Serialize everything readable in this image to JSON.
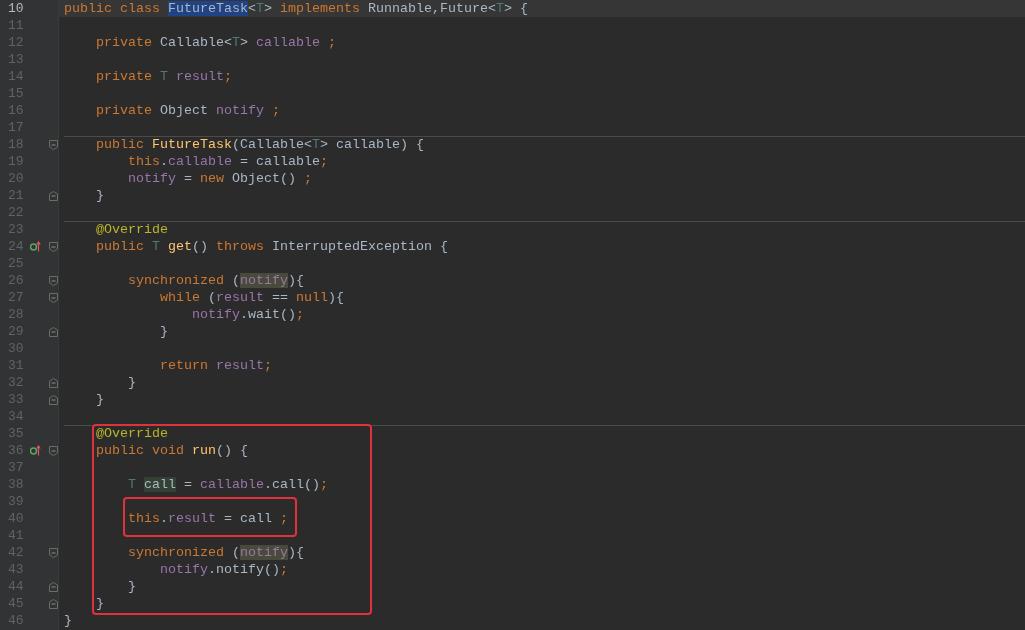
{
  "lines": [
    {
      "number": "10",
      "current": true,
      "separator": false,
      "marker": false,
      "tokens": [
        {
          "text": "public class ",
          "kind": "keyword"
        },
        {
          "text": "FutureTask",
          "kind": "selection"
        },
        {
          "text": "<",
          "kind": "plain"
        },
        {
          "text": "T",
          "kind": "type_param"
        },
        {
          "text": "> ",
          "kind": "plain"
        },
        {
          "text": "implements ",
          "kind": "keyword"
        },
        {
          "text": "Runnable,Future<",
          "kind": "plain"
        },
        {
          "text": "T",
          "kind": "type_param"
        },
        {
          "text": "> {",
          "kind": "plain"
        }
      ]
    },
    {
      "number": "11",
      "current": false,
      "separator": false,
      "marker": false
    },
    {
      "number": "12",
      "current": false,
      "separator": false,
      "marker": false,
      "tokens": [
        {
          "text": "    private ",
          "kind": "keyword"
        },
        {
          "text": "Callable<",
          "kind": "plain"
        },
        {
          "text": "T",
          "kind": "type_param"
        },
        {
          "text": "> ",
          "kind": "plain"
        },
        {
          "text": "callable",
          "kind": "field"
        },
        {
          "text": " ;",
          "kind": "keyword"
        }
      ]
    },
    {
      "number": "13",
      "current": false,
      "separator": false,
      "marker": false
    },
    {
      "number": "14",
      "current": false,
      "separator": false,
      "marker": false,
      "tokens": [
        {
          "text": "    private ",
          "kind": "keyword"
        },
        {
          "text": "T ",
          "kind": "type_param"
        },
        {
          "text": "result",
          "kind": "field"
        },
        {
          "text": ";",
          "kind": "keyword"
        }
      ]
    },
    {
      "number": "15",
      "current": false,
      "separator": false,
      "marker": false
    },
    {
      "number": "16",
      "current": false,
      "separator": false,
      "marker": false,
      "tokens": [
        {
          "text": "    private ",
          "kind": "keyword"
        },
        {
          "text": "Object ",
          "kind": "plain"
        },
        {
          "text": "notify",
          "kind": "field"
        },
        {
          "text": " ;",
          "kind": "keyword"
        }
      ]
    },
    {
      "number": "17",
      "current": false,
      "separator": false,
      "marker": false
    },
    {
      "number": "18",
      "kind": "fold_start",
      "current": false,
      "separator": true,
      "marker": false,
      "tokens": [
        {
          "text": "    public ",
          "kind": "keyword"
        },
        {
          "text": "FutureTask",
          "kind": "method"
        },
        {
          "text": "(Callable<",
          "kind": "plain"
        },
        {
          "text": "T",
          "kind": "type_param"
        },
        {
          "text": "> callable) {",
          "kind": "plain"
        }
      ]
    },
    {
      "number": "19",
      "current": false,
      "separator": false,
      "marker": false,
      "tokens": [
        {
          "text": "        this",
          "kind": "keyword"
        },
        {
          "text": ".",
          "kind": "plain"
        },
        {
          "text": "callable",
          "kind": "field"
        },
        {
          "text": " = callable",
          "kind": "plain"
        },
        {
          "text": ";",
          "kind": "keyword"
        }
      ]
    },
    {
      "number": "20",
      "current": false,
      "separator": false,
      "marker": false,
      "tokens": [
        {
          "text": "        notify",
          "kind": "field"
        },
        {
          "text": " = ",
          "kind": "plain"
        },
        {
          "text": "new ",
          "kind": "keyword"
        },
        {
          "text": "Object() ",
          "kind": "plain"
        },
        {
          "text": ";",
          "kind": "keyword"
        }
      ]
    },
    {
      "number": "21",
      "kind": "fold_end",
      "current": false,
      "separator": false,
      "marker": false,
      "tokens": [
        {
          "text": "    }",
          "kind": "plain"
        }
      ]
    },
    {
      "number": "22",
      "current": false,
      "separator": false,
      "marker": false
    },
    {
      "number": "23",
      "current": false,
      "separator": true,
      "marker": false,
      "tokens": [
        {
          "text": "    @Override",
          "kind": "annotation"
        }
      ]
    },
    {
      "number": "24",
      "kind": "fold_start",
      "current": false,
      "separator": false,
      "marker": true,
      "tokens": [
        {
          "text": "    public ",
          "kind": "keyword"
        },
        {
          "text": "T ",
          "kind": "type_param"
        },
        {
          "text": "get",
          "kind": "method"
        },
        {
          "text": "() ",
          "kind": "plain"
        },
        {
          "text": "throws ",
          "kind": "keyword"
        },
        {
          "text": "InterruptedException {",
          "kind": "plain"
        }
      ]
    },
    {
      "number": "25",
      "current": false,
      "separator": false,
      "marker": false
    },
    {
      "number": "26",
      "kind": "fold_start",
      "current": false,
      "separator": false,
      "marker": false,
      "tokens": [
        {
          "text": "        synchronized ",
          "kind": "keyword"
        },
        {
          "text": "(",
          "kind": "plain"
        },
        {
          "text": "notify",
          "kind": "read_usage"
        },
        {
          "text": "){",
          "kind": "plain"
        }
      ]
    },
    {
      "number": "27",
      "kind": "fold_start",
      "current": false,
      "separator": false,
      "marker": false,
      "tokens": [
        {
          "text": "            while ",
          "kind": "keyword"
        },
        {
          "text": "(",
          "kind": "plain"
        },
        {
          "text": "result",
          "kind": "field"
        },
        {
          "text": " == ",
          "kind": "plain"
        },
        {
          "text": "null",
          "kind": "keyword"
        },
        {
          "text": "){",
          "kind": "plain"
        }
      ]
    },
    {
      "number": "28",
      "current": false,
      "separator": false,
      "marker": false,
      "tokens": [
        {
          "text": "                notify",
          "kind": "field"
        },
        {
          "text": ".wait()",
          "kind": "plain"
        },
        {
          "text": ";",
          "kind": "keyword"
        }
      ]
    },
    {
      "number": "29",
      "kind": "fold_end",
      "current": false,
      "separator": false,
      "marker": false,
      "tokens": [
        {
          "text": "            }",
          "kind": "plain"
        }
      ]
    },
    {
      "number": "30",
      "current": false,
      "separator": false,
      "marker": false
    },
    {
      "number": "31",
      "current": false,
      "separator": false,
      "marker": false,
      "tokens": [
        {
          "text": "            return ",
          "kind": "keyword"
        },
        {
          "text": "result",
          "kind": "field"
        },
        {
          "text": ";",
          "kind": "keyword"
        }
      ]
    },
    {
      "number": "32",
      "kind": "fold_end",
      "current": false,
      "separator": false,
      "marker": false,
      "tokens": [
        {
          "text": "        }",
          "kind": "plain"
        }
      ]
    },
    {
      "number": "33",
      "kind": "fold_end",
      "current": false,
      "separator": false,
      "marker": false,
      "tokens": [
        {
          "text": "    }",
          "kind": "plain"
        }
      ]
    },
    {
      "number": "34",
      "current": false,
      "separator": false,
      "marker": false
    },
    {
      "kind": "callout",
      "children": [
        {
          "number": "35",
          "current": false,
          "separator": true,
          "marker": false,
          "tokens": [
            {
              "text": "    @Override",
              "kind": "annotation"
            }
          ]
        },
        {
          "number": "36",
          "kind": "fold_start",
          "current": false,
          "separator": false,
          "marker": true,
          "tokens": [
            {
              "text": "    public void ",
              "kind": "keyword"
            },
            {
              "text": "run",
              "kind": "method"
            },
            {
              "text": "() {",
              "kind": "plain"
            }
          ]
        },
        {
          "number": "37",
          "current": false,
          "separator": false,
          "marker": false
        },
        {
          "number": "38",
          "current": false,
          "separator": false,
          "marker": false,
          "tokens": [
            {
              "text": "        T ",
              "kind": "type_param"
            },
            {
              "text": "call",
              "kind": "write_usage"
            },
            {
              "text": " = ",
              "kind": "plain"
            },
            {
              "text": "callable",
              "kind": "field"
            },
            {
              "text": ".call()",
              "kind": "plain"
            },
            {
              "text": ";",
              "kind": "keyword"
            }
          ]
        },
        {
          "number": "39",
          "current": false,
          "separator": false,
          "marker": false
        },
        {
          "kind": "callout",
          "children": [
            {
              "number": "40",
              "current": false,
              "separator": false,
              "marker": false,
              "tokens": [
                {
                  "text": "        this",
                  "kind": "keyword"
                },
                {
                  "text": ".",
                  "kind": "plain"
                },
                {
                  "text": "result",
                  "kind": "field"
                },
                {
                  "text": " = call ",
                  "kind": "plain"
                },
                {
                  "text": ";",
                  "kind": "keyword"
                }
              ]
            }
          ]
        },
        {
          "number": "41",
          "current": false,
          "separator": false,
          "marker": false
        },
        {
          "number": "42",
          "kind": "fold_start",
          "current": false,
          "separator": false,
          "marker": false,
          "tokens": [
            {
              "text": "        synchronized ",
              "kind": "keyword"
            },
            {
              "text": "(",
              "kind": "plain"
            },
            {
              "text": "notify",
              "kind": "read_usage"
            },
            {
              "text": "){",
              "kind": "plain"
            }
          ]
        },
        {
          "number": "43",
          "current": false,
          "separator": false,
          "marker": false,
          "tokens": [
            {
              "text": "            notify",
              "kind": "field"
            },
            {
              "text": ".notify()",
              "kind": "plain"
            },
            {
              "text": ";",
              "kind": "keyword"
            }
          ]
        },
        {
          "number": "44",
          "kind": "fold_end",
          "current": false,
          "separator": false,
          "marker": false,
          "tokens": [
            {
              "text": "        }",
              "kind": "plain"
            }
          ]
        },
        {
          "number": "45",
          "kind": "fold_end",
          "current": false,
          "separator": false,
          "marker": false,
          "tokens": [
            {
              "text": "    }",
              "kind": "plain"
            }
          ]
        }
      ]
    },
    {
      "number": "46",
      "current": false,
      "separator": false,
      "marker": false,
      "tokens": [
        {
          "text": "}",
          "kind": "plain"
        }
      ]
    }
  ]
}
